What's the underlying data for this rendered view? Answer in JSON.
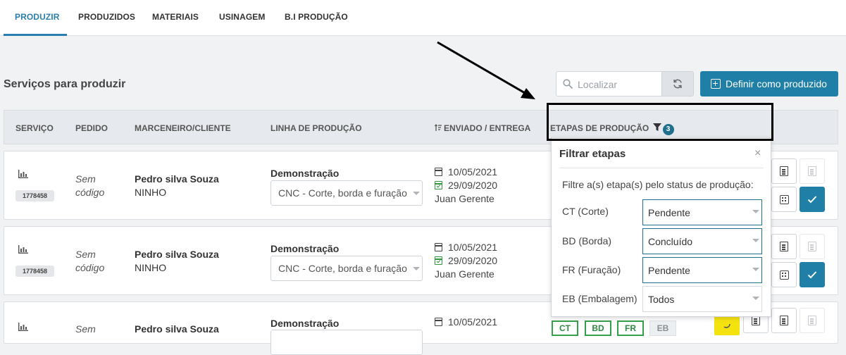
{
  "tabs": [
    {
      "label": "PRODUZIR"
    },
    {
      "label": "PRODUZIDOS"
    },
    {
      "label": "MATERIAIS"
    },
    {
      "label": "USINAGEM"
    },
    {
      "label": "B.I PRODUÇÃO"
    }
  ],
  "page_title": "Serviços para produzir",
  "search": {
    "placeholder": "Localizar"
  },
  "define_button": {
    "label": "Definir como produzido"
  },
  "columns": {
    "servico": "SERVIÇO",
    "pedido": "PEDIDO",
    "cliente": "MARCENEIRO/CLIENTE",
    "linha": "LINHA DE PRODUÇÃO",
    "enviado": "ENVIADO / ENTREGA",
    "etapas": "ETAPAS DE PRODUÇÃO",
    "etapas_badge": "3"
  },
  "rows": [
    {
      "id": "1778458",
      "pedido_line1": "Sem",
      "pedido_line2": "código",
      "cliente": "Pedro silva Souza",
      "cliente_sub": "NINHO",
      "linha_label": "Demonstração",
      "linha_value": "CNC - Corte, borda e furação",
      "enviado": "10/05/2021",
      "entrega": "29/09/2020",
      "responsavel": "Juan Gerente"
    },
    {
      "id": "1778458",
      "pedido_line1": "Sem",
      "pedido_line2": "código",
      "cliente": "Pedro silva Souza",
      "cliente_sub": "NINHO",
      "linha_label": "Demonstração",
      "linha_value": "CNC - Corte, borda e furação",
      "enviado": "10/05/2021",
      "entrega": "29/09/2020",
      "responsavel": "Juan Gerente"
    },
    {
      "pedido_line1": "Sem",
      "cliente": "Pedro silva Souza",
      "linha_label": "Demonstração",
      "enviado": "10/05/2021",
      "stages": [
        "CT",
        "BD",
        "FR",
        "EB"
      ]
    }
  ],
  "filter_popover": {
    "title": "Filtrar etapas",
    "close": "×",
    "description": "Filtre a(s) etapa(s) pelo status de produção:",
    "filters": [
      {
        "label": "CT (Corte)",
        "value": "Pendente"
      },
      {
        "label": "BD (Borda)",
        "value": "Concluído"
      },
      {
        "label": "FR (Furação)",
        "value": "Pendente"
      },
      {
        "label": "EB (Embalagem)",
        "value": "Todos"
      }
    ]
  },
  "colors": {
    "accent": "#2a7fb0",
    "primary_button": "#1f7fa6",
    "stage_done": "#35a04a",
    "highlight": "#000000"
  }
}
